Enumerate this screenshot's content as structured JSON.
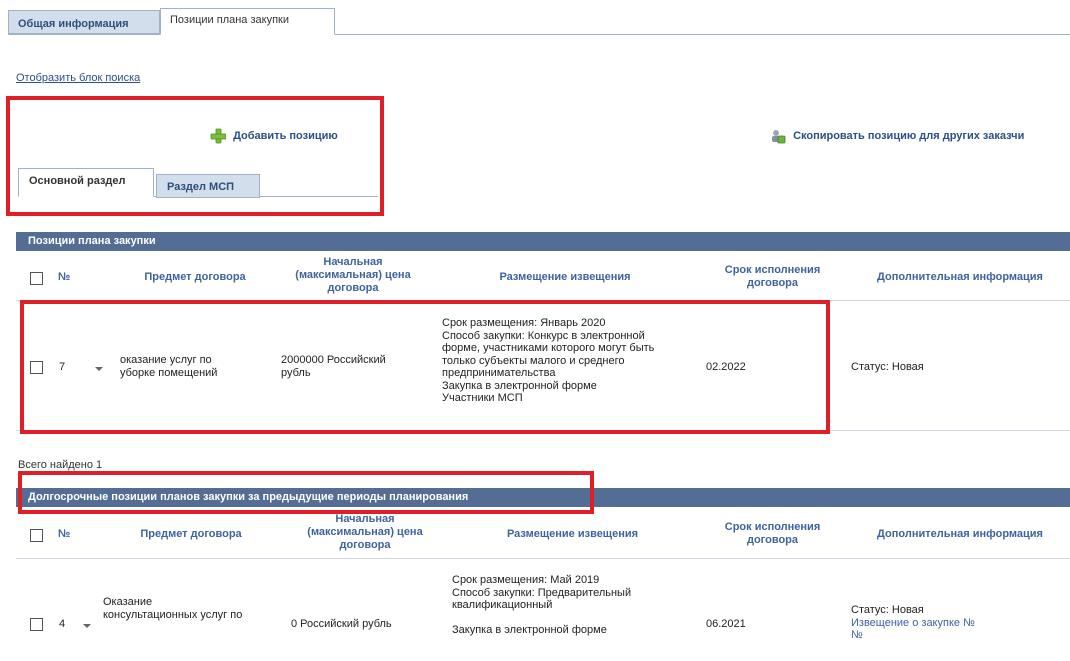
{
  "top_tabs": {
    "general": "Общая информация",
    "positions": "Позиции плана закупки"
  },
  "search_link": "Отобразить блок поиска",
  "actions": {
    "add_position": "Добавить позицию",
    "copy_position": "Скопировать позицию для других заказчи"
  },
  "inner_tabs": {
    "main": "Основной раздел",
    "msp": "Раздел МСП"
  },
  "columns": {
    "number": "№",
    "subject": "Предмет договора",
    "price_lines": [
      "Начальная",
      "(максимальная) цена",
      "договора"
    ],
    "placement": "Размещение извещения",
    "term_lines": [
      "Срок исполнения",
      "договора"
    ],
    "extra": "Дополнительная информация"
  },
  "section1": {
    "title": "Позиции плана закупки",
    "row": {
      "number": "7",
      "subject_lines": [
        "оказание услуг по",
        "уборке помещений"
      ],
      "price_lines": [
        "2000000 Российский",
        "рубль"
      ],
      "placement_lines": [
        "Срок размещения: Январь 2020",
        "Способ закупки: Конкурс в электронной",
        "форме, участниками которого могут быть",
        "только субъекты малого и среднего",
        "предпринимательства",
        "Закупка в электронной форме",
        "Участники МСП"
      ],
      "term": "02.2022",
      "status": "Статус: Новая"
    },
    "total": "Всего найдено 1"
  },
  "section2": {
    "title": "Долгосрочные позиции планов закупки за предыдущие периоды планирования",
    "row": {
      "number": "4",
      "subject_lines": [
        "Оказание",
        "консультационных услуг по"
      ],
      "price": "0 Российский рубль",
      "placement_lines": [
        "Срок размещения: Май 2019",
        "Способ закупки: Предварительный",
        "квалификационный",
        "",
        "Закупка в электронной форме"
      ],
      "term": "06.2021",
      "status": "Статус: Новая",
      "notice_lines": [
        "Извещение о закупке №",
        "№"
      ]
    }
  },
  "colors": {
    "section_header": "#536d94",
    "highlight": "#e01e25",
    "link": "#2b4f8a",
    "inactive_tab": "#d2deeb"
  }
}
